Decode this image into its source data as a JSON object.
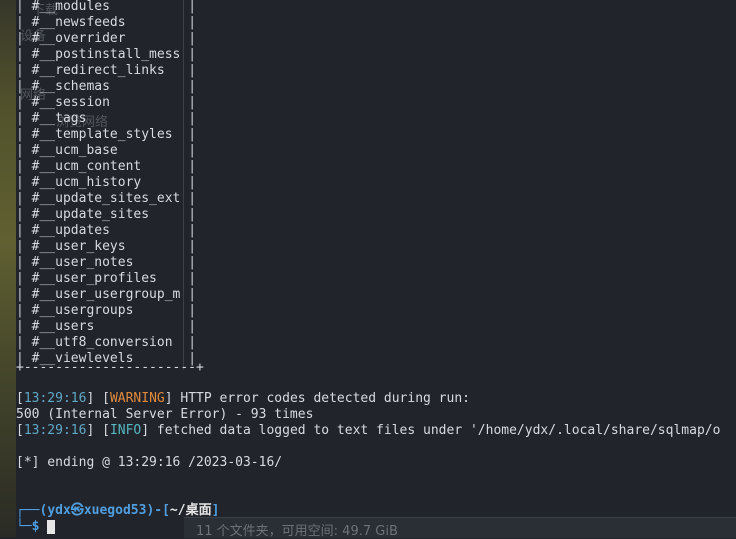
{
  "ghost_overlay": {
    "item1": "下载",
    "item2": "设备",
    "item3": "网络",
    "item4": "浏览网络"
  },
  "table_rows": [
    "#__modules",
    "#__newsfeeds",
    "#__overrider",
    "#__postinstall_mess",
    "#__redirect_links",
    "#__schemas",
    "#__session",
    "#__tags",
    "#__template_styles",
    "#__ucm_base",
    "#__ucm_content",
    "#__ucm_history",
    "#__update_sites_ext",
    "#__update_sites",
    "#__updates",
    "#__user_keys",
    "#__user_notes",
    "#__user_profiles",
    "#__user_usergroup_m",
    "#__usergroups",
    "#__users",
    "#__utf8_conversion",
    "#__viewlevels"
  ],
  "table_border": "+----------------------+",
  "log": {
    "line1_time": "13:29:16",
    "line1_level": "WARNING",
    "line1_msg": " HTTP error codes detected during run:",
    "line2": "500 (Internal Server Error) - 93 times",
    "line3_time": "13:29:16",
    "line3_level": "INFO",
    "line3_msg": " fetched data logged to text files under '/home/ydx/.local/share/sqlmap/o",
    "ending": "[*] ending @ 13:29:16 /2023-03-16/"
  },
  "prompt": {
    "user": "ydx",
    "at_symbol": "㉿",
    "host": "xuegod53",
    "dir": "~/桌面",
    "symbol": "$"
  },
  "status_bar": "11 个文件夹，可用空间: 49.7 GiB",
  "colors": {
    "background": "#21252b",
    "timestamp": "#5fa8c8",
    "warning": "#e0893b",
    "info": "#56b6c2",
    "prompt_user": "#4f9ee0"
  }
}
